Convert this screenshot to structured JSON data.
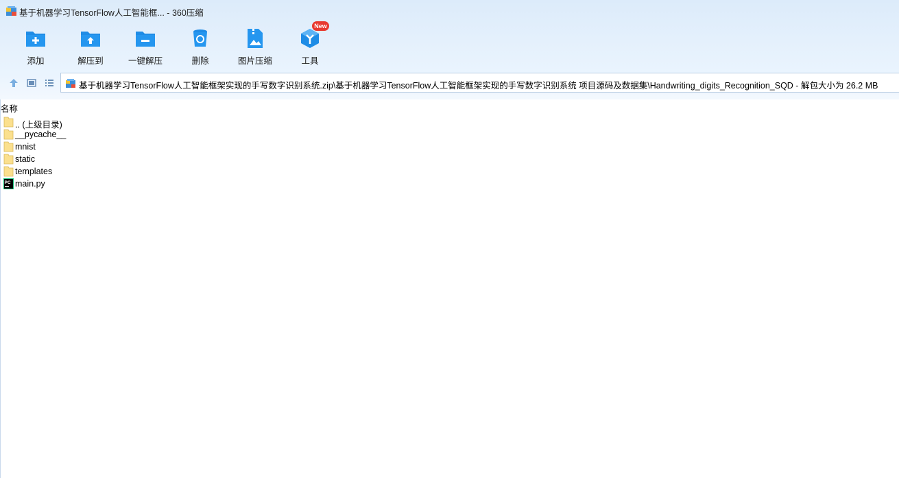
{
  "window": {
    "title": "基于机器学习TensorFlow人工智能框... - 360压缩"
  },
  "toolbar": {
    "items": [
      {
        "label": "添加",
        "icon": "add-icon"
      },
      {
        "label": "解压到",
        "icon": "extract-to-icon"
      },
      {
        "label": "一键解压",
        "icon": "one-click-extract-icon"
      },
      {
        "label": "删除",
        "icon": "delete-icon"
      },
      {
        "label": "图片压缩",
        "icon": "image-compress-icon"
      },
      {
        "label": "工具",
        "icon": "tools-icon"
      }
    ],
    "new_badge": "New"
  },
  "navbar": {
    "path": "基于机器学习TensorFlow人工智能框架实现的手写数字识别系统.zip\\基于机器学习TensorFlow人工智能框架实现的手写数字识别系统 项目源码及数据集\\Handwriting_digits_Recognition_SQD - 解包大小为 26.2 MB"
  },
  "filelist": {
    "column_name": "名称",
    "files": [
      {
        "name": ".. (上级目录)",
        "type": "folder"
      },
      {
        "name": "__pycache__",
        "type": "folder"
      },
      {
        "name": "mnist",
        "type": "folder"
      },
      {
        "name": "static",
        "type": "folder"
      },
      {
        "name": "templates",
        "type": "folder"
      },
      {
        "name": "main.py",
        "type": "pycharm-file"
      }
    ]
  },
  "colors": {
    "accent": "#1e8ce6",
    "folder": "#fbe08e",
    "badge": "#e8392f"
  }
}
